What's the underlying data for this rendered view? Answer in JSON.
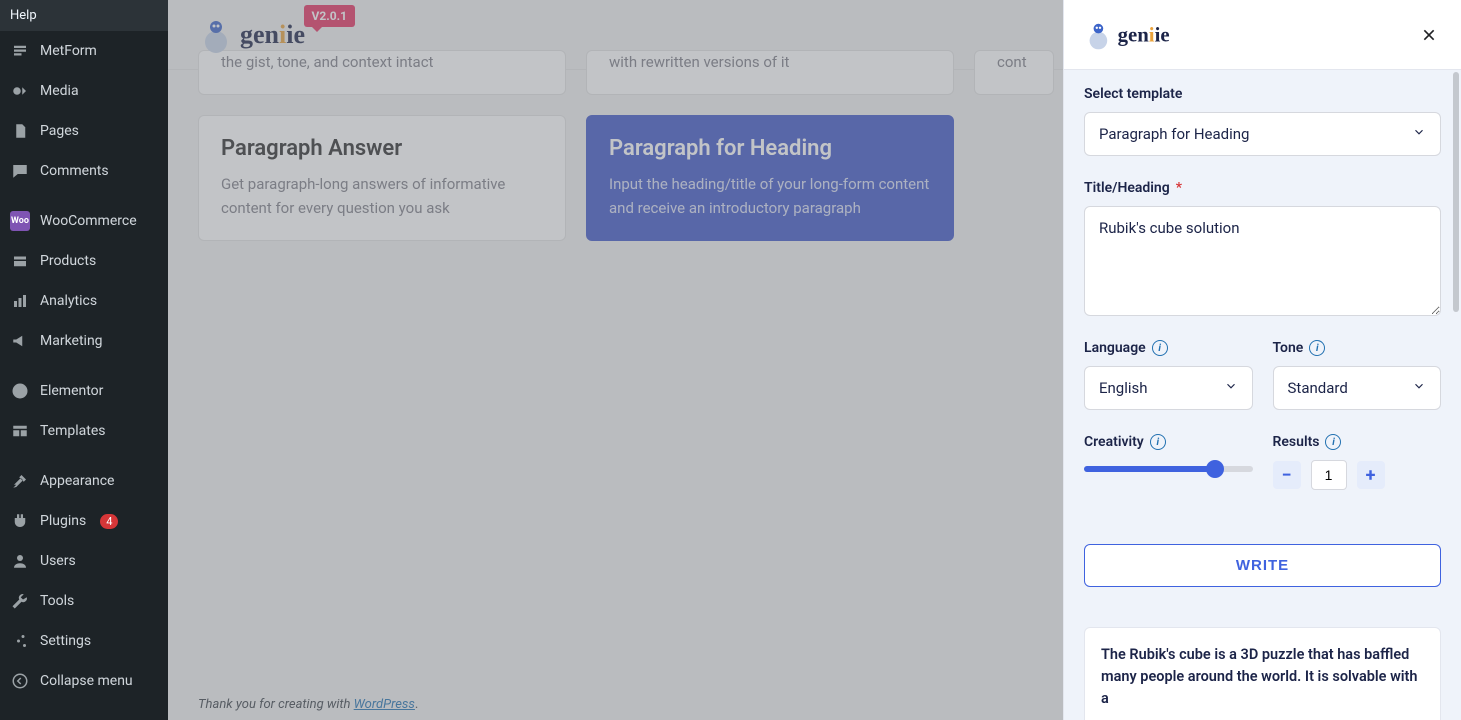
{
  "sidebar": {
    "help": "Help",
    "items": [
      {
        "label": "MetForm",
        "icon": "metform"
      },
      {
        "label": "Media",
        "icon": "media"
      },
      {
        "label": "Pages",
        "icon": "pages"
      },
      {
        "label": "Comments",
        "icon": "comments"
      },
      {
        "spacer": true
      },
      {
        "label": "WooCommerce",
        "icon": "woo"
      },
      {
        "label": "Products",
        "icon": "products"
      },
      {
        "label": "Analytics",
        "icon": "analytics"
      },
      {
        "label": "Marketing",
        "icon": "marketing"
      },
      {
        "spacer": true
      },
      {
        "label": "Elementor",
        "icon": "elementor"
      },
      {
        "label": "Templates",
        "icon": "templates"
      },
      {
        "spacer": true
      },
      {
        "label": "Appearance",
        "icon": "appearance"
      },
      {
        "label": "Plugins",
        "icon": "plugins",
        "badge": "4"
      },
      {
        "label": "Users",
        "icon": "users"
      },
      {
        "label": "Tools",
        "icon": "tools"
      },
      {
        "label": "Settings",
        "icon": "settings"
      }
    ],
    "collapse": "Collapse menu"
  },
  "brand": {
    "name_a": "gen",
    "name_b": "ie",
    "version": "V2.0.1"
  },
  "cards": {
    "row1": [
      {
        "desc_tail": "the gist, tone, and context intact"
      },
      {
        "desc_tail": "with rewritten versions of it"
      },
      {
        "desc_tail_prefix": "cont"
      }
    ],
    "row2": [
      {
        "title": "Paragraph Answer",
        "desc": "Get paragraph-long answers of informative content for every question you ask"
      },
      {
        "title": "Paragraph for Heading",
        "desc": "Input the heading/title of your long-form content and receive an introductory paragraph",
        "active": true
      }
    ]
  },
  "footer": {
    "prefix": "Thank you for creating with ",
    "link": "WordPress",
    "period": "."
  },
  "panel": {
    "template_label": "Select template",
    "template_value": "Paragraph for Heading",
    "heading_label": "Title/Heading",
    "heading_value": "Rubik's cube solution",
    "language_label": "Language",
    "language_value": "English",
    "tone_label": "Tone",
    "tone_value": "Standard",
    "creativity_label": "Creativity",
    "results_label": "Results",
    "results_value": "1",
    "write_btn": "WRITE",
    "result_text": "The Rubik's cube is a 3D puzzle that has baffled many people around the world. It is solvable with a"
  }
}
